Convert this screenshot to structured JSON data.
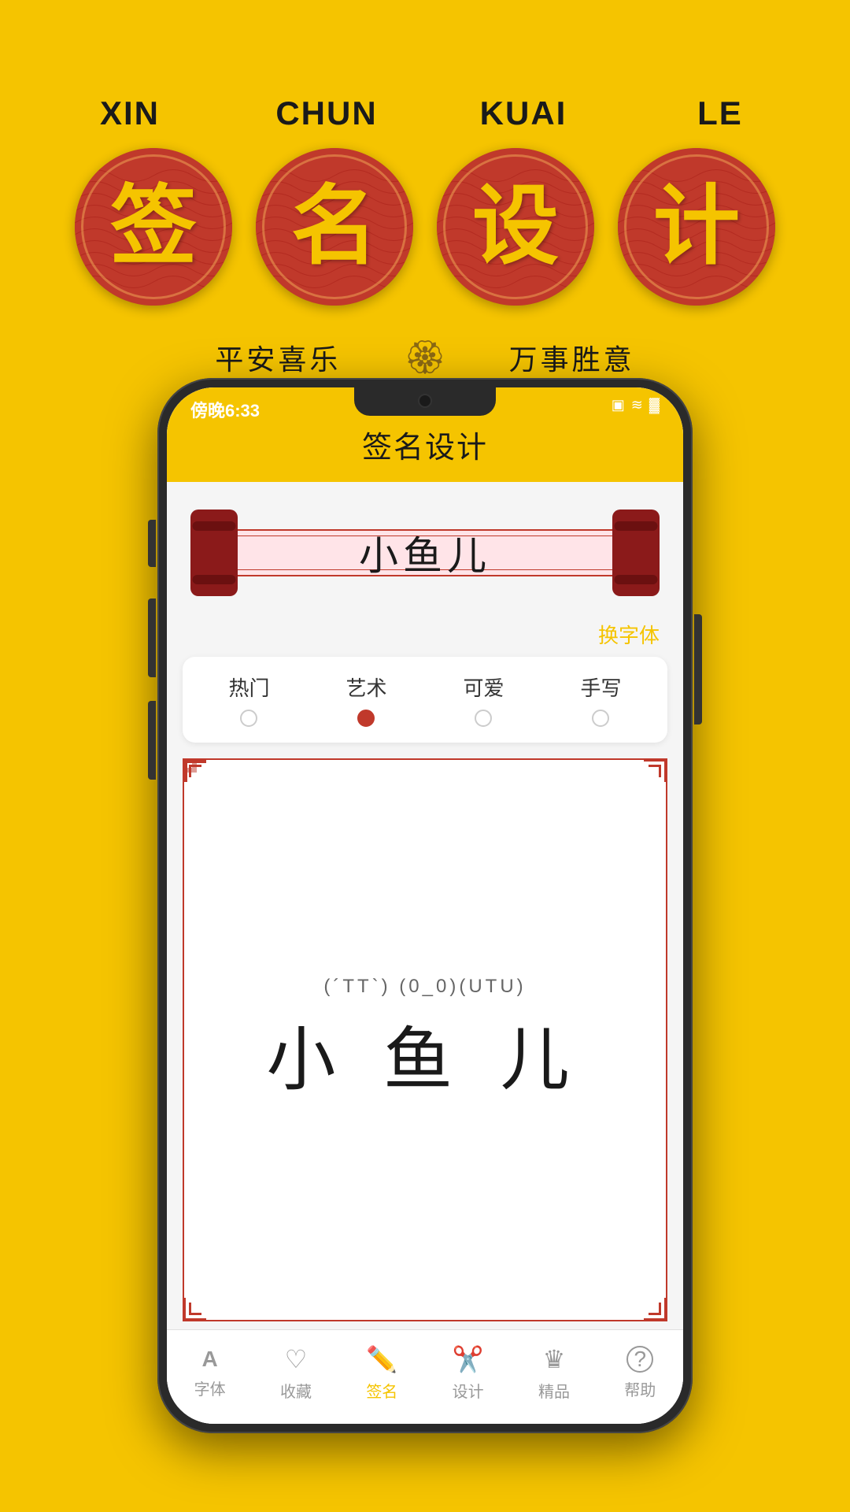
{
  "background_color": "#F5C400",
  "top": {
    "pinyin": [
      "XIN",
      "CHUN",
      "KUAI",
      "LE"
    ],
    "characters": [
      "签",
      "名",
      "设",
      "计"
    ],
    "subtitle_left": "平安喜乐",
    "subtitle_right": "万事胜意",
    "flower": "🏵"
  },
  "phone": {
    "status_bar": {
      "time": "傍晚6:33",
      "icons": "⊟ ≋ ▓"
    },
    "app_title": "签名设计",
    "scroll_name": "小鱼儿",
    "font_change_label": "换字体",
    "font_tabs": [
      {
        "label": "热门",
        "active": false
      },
      {
        "label": "艺术",
        "active": true
      },
      {
        "label": "可爱",
        "active": false
      },
      {
        "label": "手写",
        "active": false
      }
    ],
    "signature": {
      "emoticons": "(´TT`) (0_0)(UTU)",
      "name": "小 鱼 儿"
    },
    "nav_items": [
      {
        "label": "字体",
        "icon": "A",
        "active": false
      },
      {
        "label": "收藏",
        "icon": "♡",
        "active": false
      },
      {
        "label": "签名",
        "icon": "✏",
        "active": true
      },
      {
        "label": "设计",
        "icon": "✂",
        "active": false
      },
      {
        "label": "精品",
        "icon": "♛",
        "active": false
      },
      {
        "label": "帮助",
        "icon": "?",
        "active": false
      }
    ]
  }
}
